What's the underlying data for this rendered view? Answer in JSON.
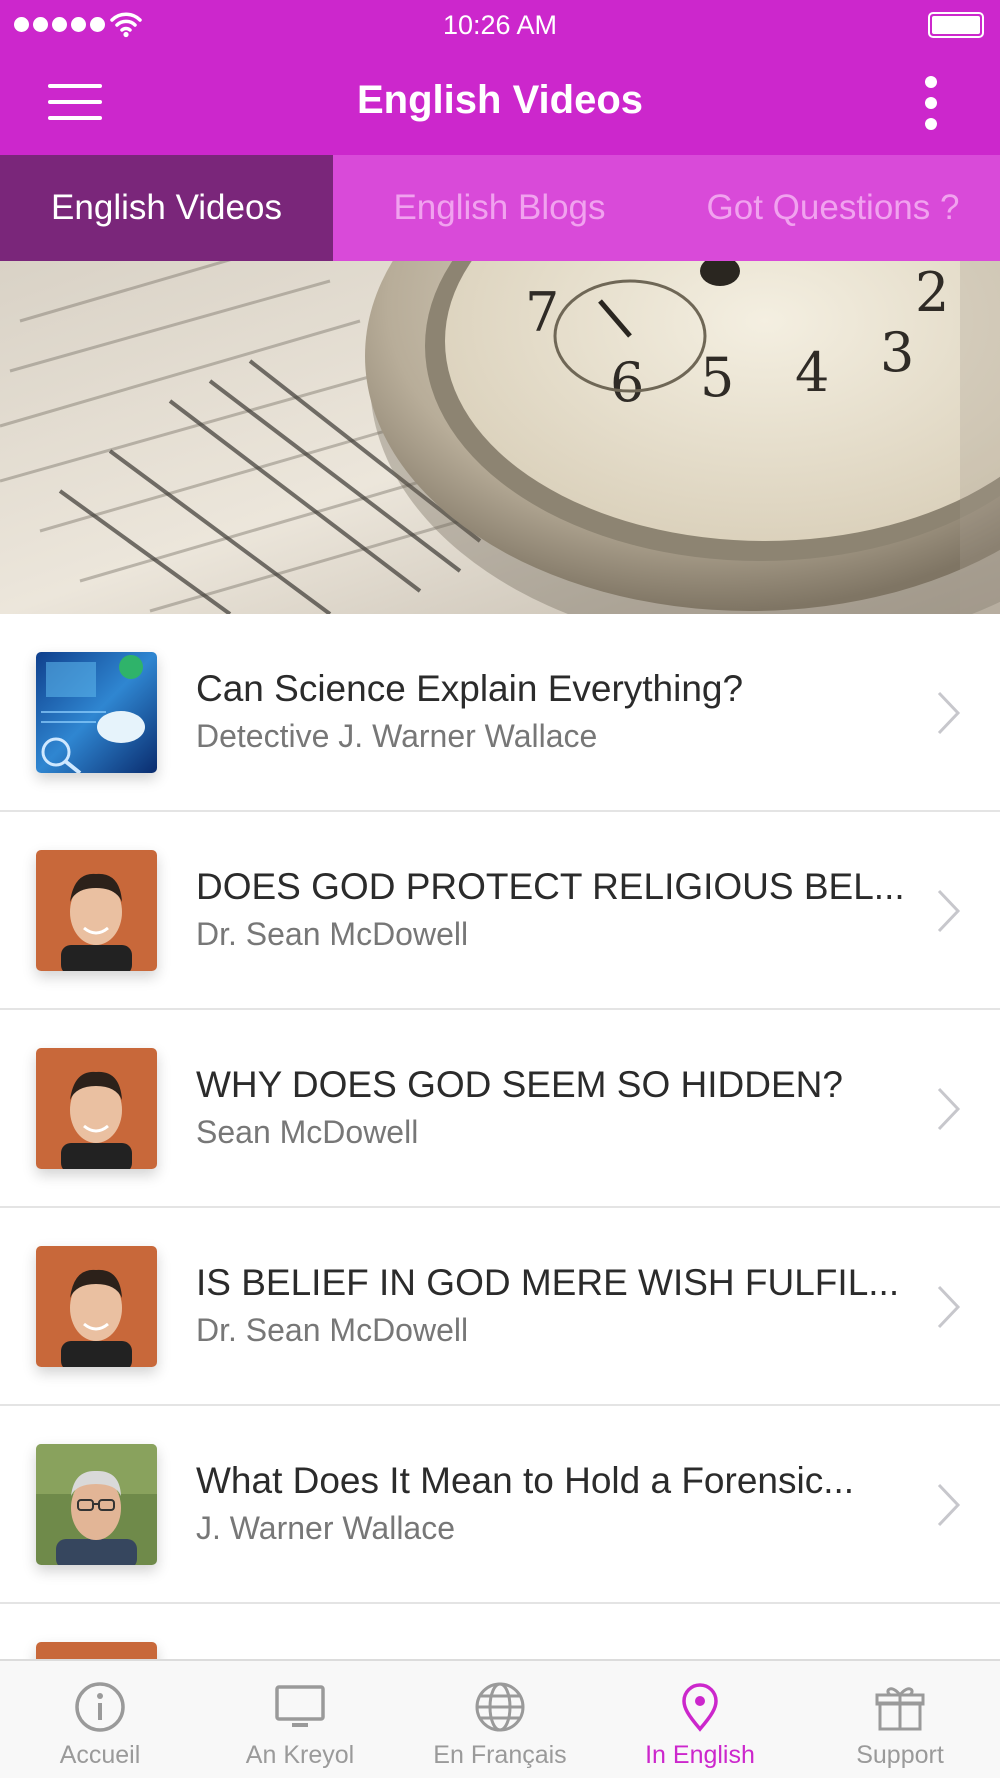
{
  "status_bar": {
    "time": "10:26 AM",
    "signal_bars": 5,
    "battery_level": 1.0
  },
  "navbar": {
    "title": "English Videos",
    "menu_icon": "hamburger-menu-icon",
    "more_icon": "vertical-ellipsis-icon"
  },
  "tabs": [
    {
      "label": "English Videos",
      "active": true
    },
    {
      "label": "English Blogs",
      "active": false
    },
    {
      "label": "Got Questions ?",
      "active": false
    }
  ],
  "hero": {
    "image": "pocket-watch-on-book-photo"
  },
  "videos": [
    {
      "title": "Can Science Explain Everything?",
      "author": "Detective J. Warner Wallace",
      "thumbnail": "science-thumbnail"
    },
    {
      "title": "DOES GOD PROTECT RELIGIOUS BEL...",
      "author": "Dr. Sean McDowell",
      "thumbnail": "sean-mcdowell-portrait"
    },
    {
      "title": "WHY DOES GOD SEEM SO HIDDEN?",
      "author": "Sean McDowell",
      "thumbnail": "sean-mcdowell-portrait"
    },
    {
      "title": "IS BELIEF IN GOD MERE WISH FULFIL...",
      "author": "Dr. Sean McDowell",
      "thumbnail": "sean-mcdowell-portrait"
    },
    {
      "title": "What Does It Mean to Hold a Forensic...",
      "author": "J. Warner Wallace",
      "thumbnail": "warner-wallace-portrait"
    },
    {
      "title": "",
      "author": "",
      "thumbnail": "sean-mcdowell-portrait"
    }
  ],
  "bottom_tabs": [
    {
      "label": "Accueil",
      "icon": "info-circle-icon",
      "active": false
    },
    {
      "label": "An Kreyol",
      "icon": "monitor-icon",
      "active": false
    },
    {
      "label": "En Français",
      "icon": "globe-icon",
      "active": false
    },
    {
      "label": "In English",
      "icon": "location-pin-icon",
      "active": true
    },
    {
      "label": "Support",
      "icon": "gift-icon",
      "active": false
    }
  ],
  "colors": {
    "primary": "#cc27cc",
    "tab_bar": "#d94ad9",
    "tab_active": "#7a267a",
    "inactive_tab_text": "#f1a2ef",
    "bottom_inactive": "#9a9a9a"
  }
}
